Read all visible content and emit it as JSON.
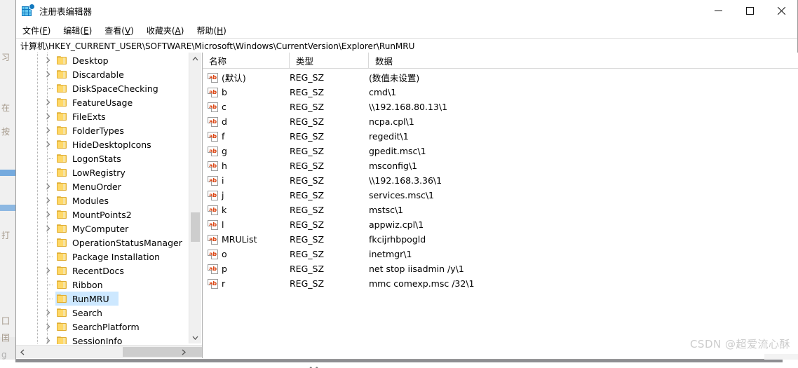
{
  "window": {
    "title": "注册表编辑器",
    "icon": "regedit-icon",
    "controls": {
      "minimize": "minimize-button",
      "maximize": "maximize-button",
      "close": "close-button"
    }
  },
  "menubar": {
    "items": [
      {
        "label": "文件(F)",
        "text": "文件(",
        "accel": "F",
        "tail": ")"
      },
      {
        "label": "编辑(E)",
        "text": "编辑(",
        "accel": "E",
        "tail": ")"
      },
      {
        "label": "查看(V)",
        "text": "查看(",
        "accel": "V",
        "tail": ")"
      },
      {
        "label": "收藏夹(A)",
        "text": "收藏夹(",
        "accel": "A",
        "tail": ")"
      },
      {
        "label": "帮助(H)",
        "text": "帮助(",
        "accel": "H",
        "tail": ")"
      }
    ]
  },
  "address": {
    "path": "计算机\\HKEY_CURRENT_USER\\SOFTWARE\\Microsoft\\Windows\\CurrentVersion\\Explorer\\RunMRU"
  },
  "tree": {
    "items": [
      {
        "label": "Desktop",
        "expandable": true,
        "selected": false
      },
      {
        "label": "Discardable",
        "expandable": true,
        "selected": false
      },
      {
        "label": "DiskSpaceChecking",
        "expandable": false,
        "selected": false
      },
      {
        "label": "FeatureUsage",
        "expandable": true,
        "selected": false
      },
      {
        "label": "FileExts",
        "expandable": true,
        "selected": false
      },
      {
        "label": "FolderTypes",
        "expandable": true,
        "selected": false
      },
      {
        "label": "HideDesktopIcons",
        "expandable": true,
        "selected": false
      },
      {
        "label": "LogonStats",
        "expandable": false,
        "selected": false
      },
      {
        "label": "LowRegistry",
        "expandable": false,
        "selected": false
      },
      {
        "label": "MenuOrder",
        "expandable": true,
        "selected": false
      },
      {
        "label": "Modules",
        "expandable": true,
        "selected": false
      },
      {
        "label": "MountPoints2",
        "expandable": true,
        "selected": false
      },
      {
        "label": "MyComputer",
        "expandable": true,
        "selected": false
      },
      {
        "label": "OperationStatusManager",
        "expandable": false,
        "selected": false
      },
      {
        "label": "Package Installation",
        "expandable": false,
        "selected": false
      },
      {
        "label": "RecentDocs",
        "expandable": true,
        "selected": false
      },
      {
        "label": "Ribbon",
        "expandable": false,
        "selected": false
      },
      {
        "label": "RunMRU",
        "expandable": false,
        "selected": true
      },
      {
        "label": "Search",
        "expandable": true,
        "selected": false
      },
      {
        "label": "SearchPlatform",
        "expandable": true,
        "selected": false
      },
      {
        "label": "SessionInfo",
        "expandable": true,
        "selected": false
      }
    ]
  },
  "list": {
    "columns": [
      "名称",
      "类型",
      "数据"
    ],
    "rows": [
      {
        "name": "(默认)",
        "type": "REG_SZ",
        "data": "(数值未设置)"
      },
      {
        "name": "b",
        "type": "REG_SZ",
        "data": "cmd\\1"
      },
      {
        "name": "c",
        "type": "REG_SZ",
        "data": "\\\\192.168.80.13\\1"
      },
      {
        "name": "d",
        "type": "REG_SZ",
        "data": "ncpa.cpl\\1"
      },
      {
        "name": "f",
        "type": "REG_SZ",
        "data": "regedit\\1"
      },
      {
        "name": "g",
        "type": "REG_SZ",
        "data": "gpedit.msc\\1"
      },
      {
        "name": "h",
        "type": "REG_SZ",
        "data": "msconfig\\1"
      },
      {
        "name": "i",
        "type": "REG_SZ",
        "data": "\\\\192.168.3.36\\1"
      },
      {
        "name": "j",
        "type": "REG_SZ",
        "data": "services.msc\\1"
      },
      {
        "name": "k",
        "type": "REG_SZ",
        "data": "mstsc\\1"
      },
      {
        "name": "l",
        "type": "REG_SZ",
        "data": "appwiz.cpl\\1"
      },
      {
        "name": "MRUList",
        "type": "REG_SZ",
        "data": "fkcijrhbpogld"
      },
      {
        "name": "o",
        "type": "REG_SZ",
        "data": "inetmgr\\1"
      },
      {
        "name": "p",
        "type": "REG_SZ",
        "data": "net stop iisadmin /y\\1"
      },
      {
        "name": "r",
        "type": "REG_SZ",
        "data": "mmc comexp.msc /32\\1"
      }
    ],
    "value_icon_text": "ab"
  },
  "watermark": {
    "text": "CSDN @超爱流心酥"
  },
  "colors": {
    "selection": "#cde8ff",
    "folder": "#ffd866",
    "value_icon_text": "#d93f0b",
    "window_border": "#9a9a9a"
  }
}
